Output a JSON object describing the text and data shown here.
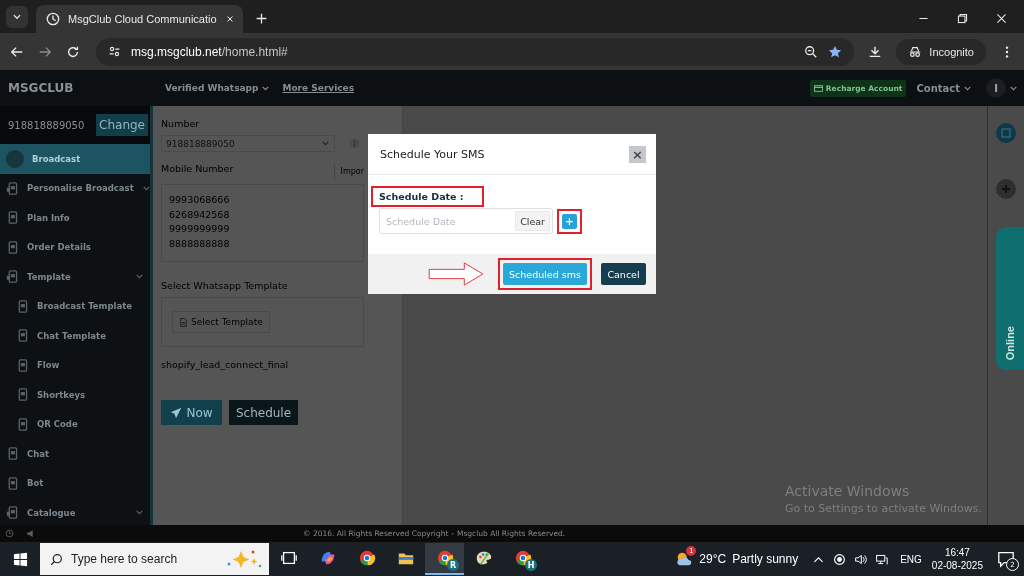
{
  "browser": {
    "tab_title": "MsgClub Cloud Communicatio",
    "url_host": "msg.msgclub.net",
    "url_path": "/home.html#",
    "profile": "Incognito"
  },
  "topbar": {
    "brand": "MSGCLUB",
    "menu": [
      {
        "label": "Verified Whatsapp",
        "kind": "dropdown"
      },
      {
        "label": "More Services",
        "kind": "link"
      }
    ],
    "recharge": "Recharge Account",
    "contact": "Contact",
    "avatar": "I"
  },
  "sender": {
    "number": "918818889050",
    "button": "Change"
  },
  "sidebar": {
    "items": [
      {
        "label": "Broadcast",
        "kind": "link",
        "selected": true
      },
      {
        "label": "Personalise Broadcast",
        "kind": "group",
        "selected": false
      },
      {
        "label": "Plan Info",
        "kind": "link",
        "selected": false
      },
      {
        "label": "Order Details",
        "kind": "link",
        "selected": false
      },
      {
        "label": "Template",
        "kind": "group",
        "selected": false,
        "children": [
          {
            "label": "Broadcast Template",
            "kind": "link",
            "selected": false
          },
          {
            "label": "Chat Template",
            "kind": "link",
            "selected": false
          },
          {
            "label": "Flow",
            "kind": "link",
            "selected": false
          },
          {
            "label": "Shortkeys",
            "kind": "link",
            "selected": false
          },
          {
            "label": "QR Code",
            "kind": "link",
            "selected": false
          }
        ]
      },
      {
        "label": "Chat",
        "kind": "link",
        "selected": false
      },
      {
        "label": "Bot",
        "kind": "link",
        "selected": false
      },
      {
        "label": "Catalogue",
        "kind": "group",
        "selected": false
      }
    ]
  },
  "form": {
    "number_label": "Number",
    "number_value": "918818889050",
    "mobile_label": "Mobile Number",
    "import_button": "Impor",
    "mobile_numbers": [
      "9993068666",
      "6268942568",
      "9999999999",
      "8888888888"
    ],
    "template_label": "Select Whatsapp Template",
    "template_button": "Select Template",
    "template_name": "shopify_lead_connect_final",
    "buttons": [
      {
        "label": "Now",
        "kind": "primary"
      },
      {
        "label": "Schedule",
        "kind": "dark"
      }
    ]
  },
  "side_tab": "Online",
  "footer": "© 2016. All Rights Reserved Copyright – Msgclub All Rights Reserved.",
  "modal": {
    "title": "Schedule Your SMS",
    "close": "×",
    "date_label": {
      "text": "Schedule Date :",
      "highlighted": true
    },
    "date_field": {
      "placeholder": "Schedule Date"
    },
    "clear_button": "Clear",
    "add_button": {
      "label": "+",
      "highlighted": true
    },
    "buttons": [
      {
        "label": "Scheduled sms",
        "kind": "primary",
        "highlighted": true
      },
      {
        "label": "Cancel",
        "kind": "dark",
        "highlighted": false
      }
    ]
  },
  "os_notice": {
    "title": "Activate Windows",
    "text": "Go to Settings to activate Windows."
  },
  "taskbar": {
    "search_placeholder": "Type here to search",
    "apps": [
      {
        "kind": "taskview",
        "selected": false
      },
      {
        "kind": "copilot",
        "selected": false
      },
      {
        "kind": "chrome",
        "selected": false
      },
      {
        "kind": "folder",
        "selected": false
      },
      {
        "kind": "chrome",
        "badge": "R",
        "selected": true
      },
      {
        "kind": "paint",
        "selected": false
      },
      {
        "kind": "chrome",
        "badge": "H",
        "selected": false
      }
    ],
    "weather_badge": "1",
    "temperature": "29°C",
    "weather": "Partly sunny",
    "language": "ENG",
    "time": "16:47",
    "date": "02-08-2025",
    "notifications": "2"
  }
}
